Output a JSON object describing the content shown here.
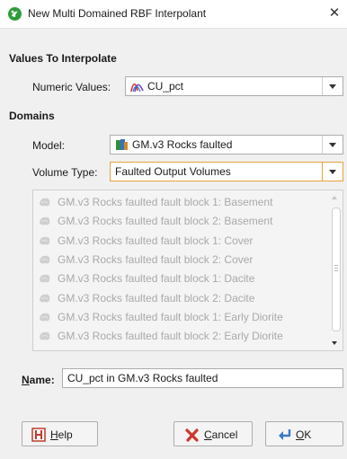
{
  "window": {
    "title": "New Multi Domained RBF Interpolant",
    "close_glyph": "✕",
    "icon": "leapfrog-app-icon"
  },
  "values_section": {
    "heading": "Values To Interpolate",
    "numeric_label": "Numeric Values:",
    "numeric_value": "CU_pct",
    "numeric_icon": "numeric-values-icon"
  },
  "domains_section": {
    "heading": "Domains",
    "model_label": "Model:",
    "model_value": "GM.v3 Rocks faulted",
    "model_icon": "geological-model-icon",
    "volume_type_label": "Volume Type:",
    "volume_type_value": "Faulted Output Volumes",
    "volumes": [
      "GM.v3 Rocks faulted fault block 1: Basement",
      "GM.v3 Rocks faulted fault block 2: Basement",
      "GM.v3 Rocks faulted fault block 1: Cover",
      "GM.v3 Rocks faulted fault block 2: Cover",
      "GM.v3 Rocks faulted fault block 1: Dacite",
      "GM.v3 Rocks faulted fault block 2: Dacite",
      "GM.v3 Rocks faulted fault block 1: Early Diorite",
      "GM.v3 Rocks faulted fault block 2: Early Diorite"
    ]
  },
  "name_field": {
    "label_mnemonic": "N",
    "label_rest": "ame:",
    "value": "CU_pct in GM.v3 Rocks faulted"
  },
  "buttons": {
    "help_mnemonic": "H",
    "help_rest": "elp",
    "cancel_mnemonic": "C",
    "cancel_rest": "ancel",
    "ok_mnemonic": "O",
    "ok_rest": "K"
  },
  "colors": {
    "focus_border": "#e8a23a",
    "disabled_text": "#a9a9a9",
    "dialog_bg": "#f0f0f0"
  }
}
